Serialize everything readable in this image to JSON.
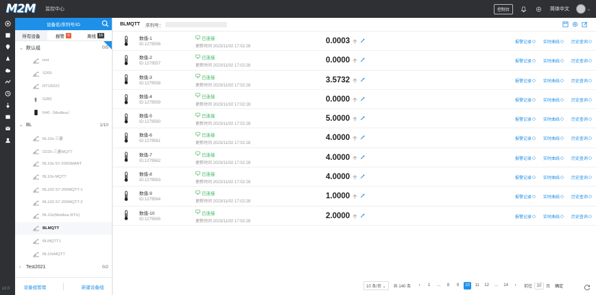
{
  "app": {
    "logo": "M2M",
    "nav_title": "监控中心"
  },
  "topbar": {
    "console_label": "控制台",
    "language": "简体中文"
  },
  "sidebar_rail": {
    "version": "v2.0"
  },
  "device_panel": {
    "search_placeholder": "设备名/序列号/ID",
    "tabs": [
      {
        "label": "所有设备",
        "badge": ""
      },
      {
        "label": "报警",
        "badge": "0"
      },
      {
        "label": "离线",
        "badge": "16"
      }
    ],
    "groups": [
      {
        "name": "默认组",
        "count": "0/5",
        "expanded": true,
        "devices": [
          "test",
          "S265",
          "RTU5022",
          "S282",
          "R40（Modbus）"
        ]
      },
      {
        "name": "BL",
        "count": "1/10",
        "expanded": true,
        "devices": [
          "BL10x-三菱",
          "D225-三菱MQTT",
          "BL10x-S7-200SMART",
          "BL10x-MQTT",
          "BL102-S7-200MQTT-1",
          "BL102-S7-200MQTT-2",
          "BL10x(Modbus RTU)",
          "BLMQTT",
          "BLMQTT1",
          "BL10xMQTT"
        ]
      },
      {
        "name": "Test2021",
        "count": "0/2",
        "expanded": false,
        "devices": []
      }
    ],
    "selected_device": "BLMQTT",
    "footer": {
      "manage_label": "设备组管理",
      "new_label": "新建设备组"
    }
  },
  "main": {
    "device_title": "BLMQTT",
    "serial_label": "序列号：",
    "rows": [
      {
        "name": "数值-1",
        "id": "ID:1279556",
        "status": "已连接",
        "time": "更新时间 2023/11/02 17:02:28",
        "value": "0.0003",
        "unit": "个"
      },
      {
        "name": "数值-2",
        "id": "ID:1279557",
        "status": "已连接",
        "time": "更新时间 2023/11/02 17:02:28",
        "value": "0.0000",
        "unit": "个"
      },
      {
        "name": "数值-3",
        "id": "ID:1279558",
        "status": "已连接",
        "time": "更新时间 2023/11/02 17:02:28",
        "value": "3.5732",
        "unit": "个"
      },
      {
        "name": "数值-4",
        "id": "ID:1279559",
        "status": "已连接",
        "time": "更新时间 2023/11/02 17:02:28",
        "value": "0.0000",
        "unit": "个"
      },
      {
        "name": "数值-5",
        "id": "ID:1279560",
        "status": "已连接",
        "time": "更新时间 2023/11/02 17:02:28",
        "value": "5.0000",
        "unit": "个"
      },
      {
        "name": "数值-6",
        "id": "ID:1279561",
        "status": "已连接",
        "time": "更新时间 2023/11/02 17:02:28",
        "value": "4.0000",
        "unit": "个"
      },
      {
        "name": "数值-7",
        "id": "ID:1279562",
        "status": "已连接",
        "time": "更新时间 2023/11/02 17:02:28",
        "value": "4.0000",
        "unit": "个"
      },
      {
        "name": "数值-8",
        "id": "ID:1279563",
        "status": "已连接",
        "time": "更新时间 2023/11/02 17:02:28",
        "value": "4.0000",
        "unit": "个"
      },
      {
        "name": "数值-9",
        "id": "ID:1279564",
        "status": "已连接",
        "time": "更新时间 2023/11/02 17:02:28",
        "value": "1.0000",
        "unit": "个"
      },
      {
        "name": "数值-10",
        "id": "ID:1279565",
        "status": "已连接",
        "time": "更新时间 2023/11/02 17:02:28",
        "value": "2.0000",
        "unit": "个"
      }
    ],
    "actions": [
      "报警记录",
      "实时曲线",
      "历史查询"
    ]
  },
  "pagination": {
    "page_size": "10 条/页",
    "total": "共 140 条",
    "pages": [
      "1",
      "...",
      "8",
      "9",
      "10",
      "11",
      "12",
      "...",
      "14"
    ],
    "current": "10",
    "goto_label": "前往",
    "goto_value": "10",
    "page_unit": "页",
    "confirm": "确定"
  },
  "colors": {
    "accent": "#1e90e8",
    "online": "#3cb35a",
    "topbar": "#2f3033"
  }
}
